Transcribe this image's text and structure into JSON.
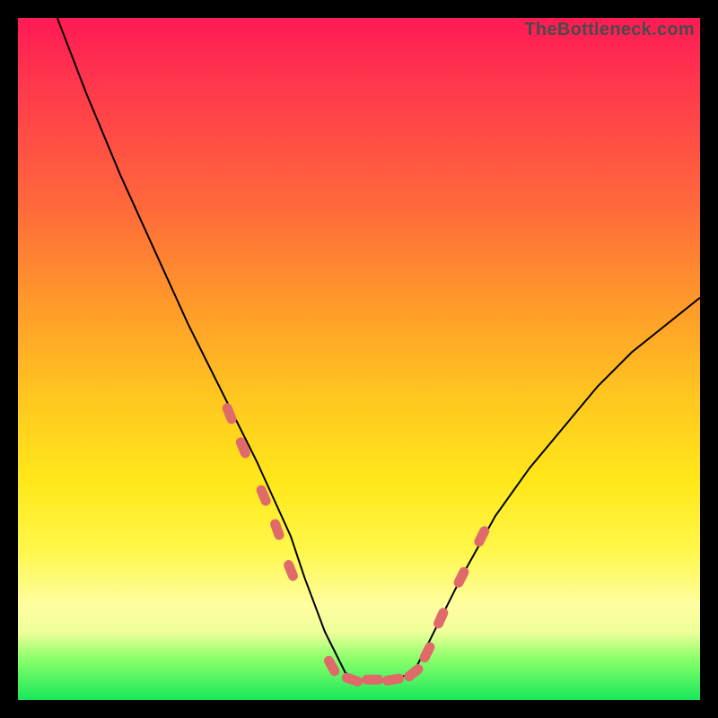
{
  "watermark": "TheBottleneck.com",
  "chart_data": {
    "type": "line",
    "title": "",
    "xlabel": "",
    "ylabel": "",
    "xlim": [
      0,
      100
    ],
    "ylim": [
      0,
      100
    ],
    "series": [
      {
        "name": "bottleneck-curve",
        "x": [
          0,
          5,
          10,
          15,
          20,
          25,
          30,
          35,
          40,
          42,
          45,
          48,
          50,
          52,
          55,
          58,
          60,
          65,
          70,
          75,
          80,
          85,
          90,
          95,
          100
        ],
        "values": [
          118,
          102,
          89,
          77,
          66,
          55,
          45,
          35,
          24,
          18,
          10,
          4,
          3,
          3,
          3,
          4,
          8,
          18,
          27,
          34,
          40,
          46,
          51,
          55,
          59
        ]
      }
    ],
    "overlay_points": {
      "name": "highlighted-segments",
      "color": "#e06a6a",
      "x": [
        31,
        33,
        36,
        38,
        40,
        46,
        49,
        52,
        55,
        58,
        60,
        62,
        65,
        68
      ],
      "values": [
        42,
        37,
        30,
        25,
        19,
        5,
        3,
        3,
        3,
        4,
        7,
        12,
        18,
        24
      ]
    },
    "background_gradient": {
      "top": "#ff1a55",
      "middle": "#ffe81a",
      "bottom": "#17e85a"
    }
  }
}
